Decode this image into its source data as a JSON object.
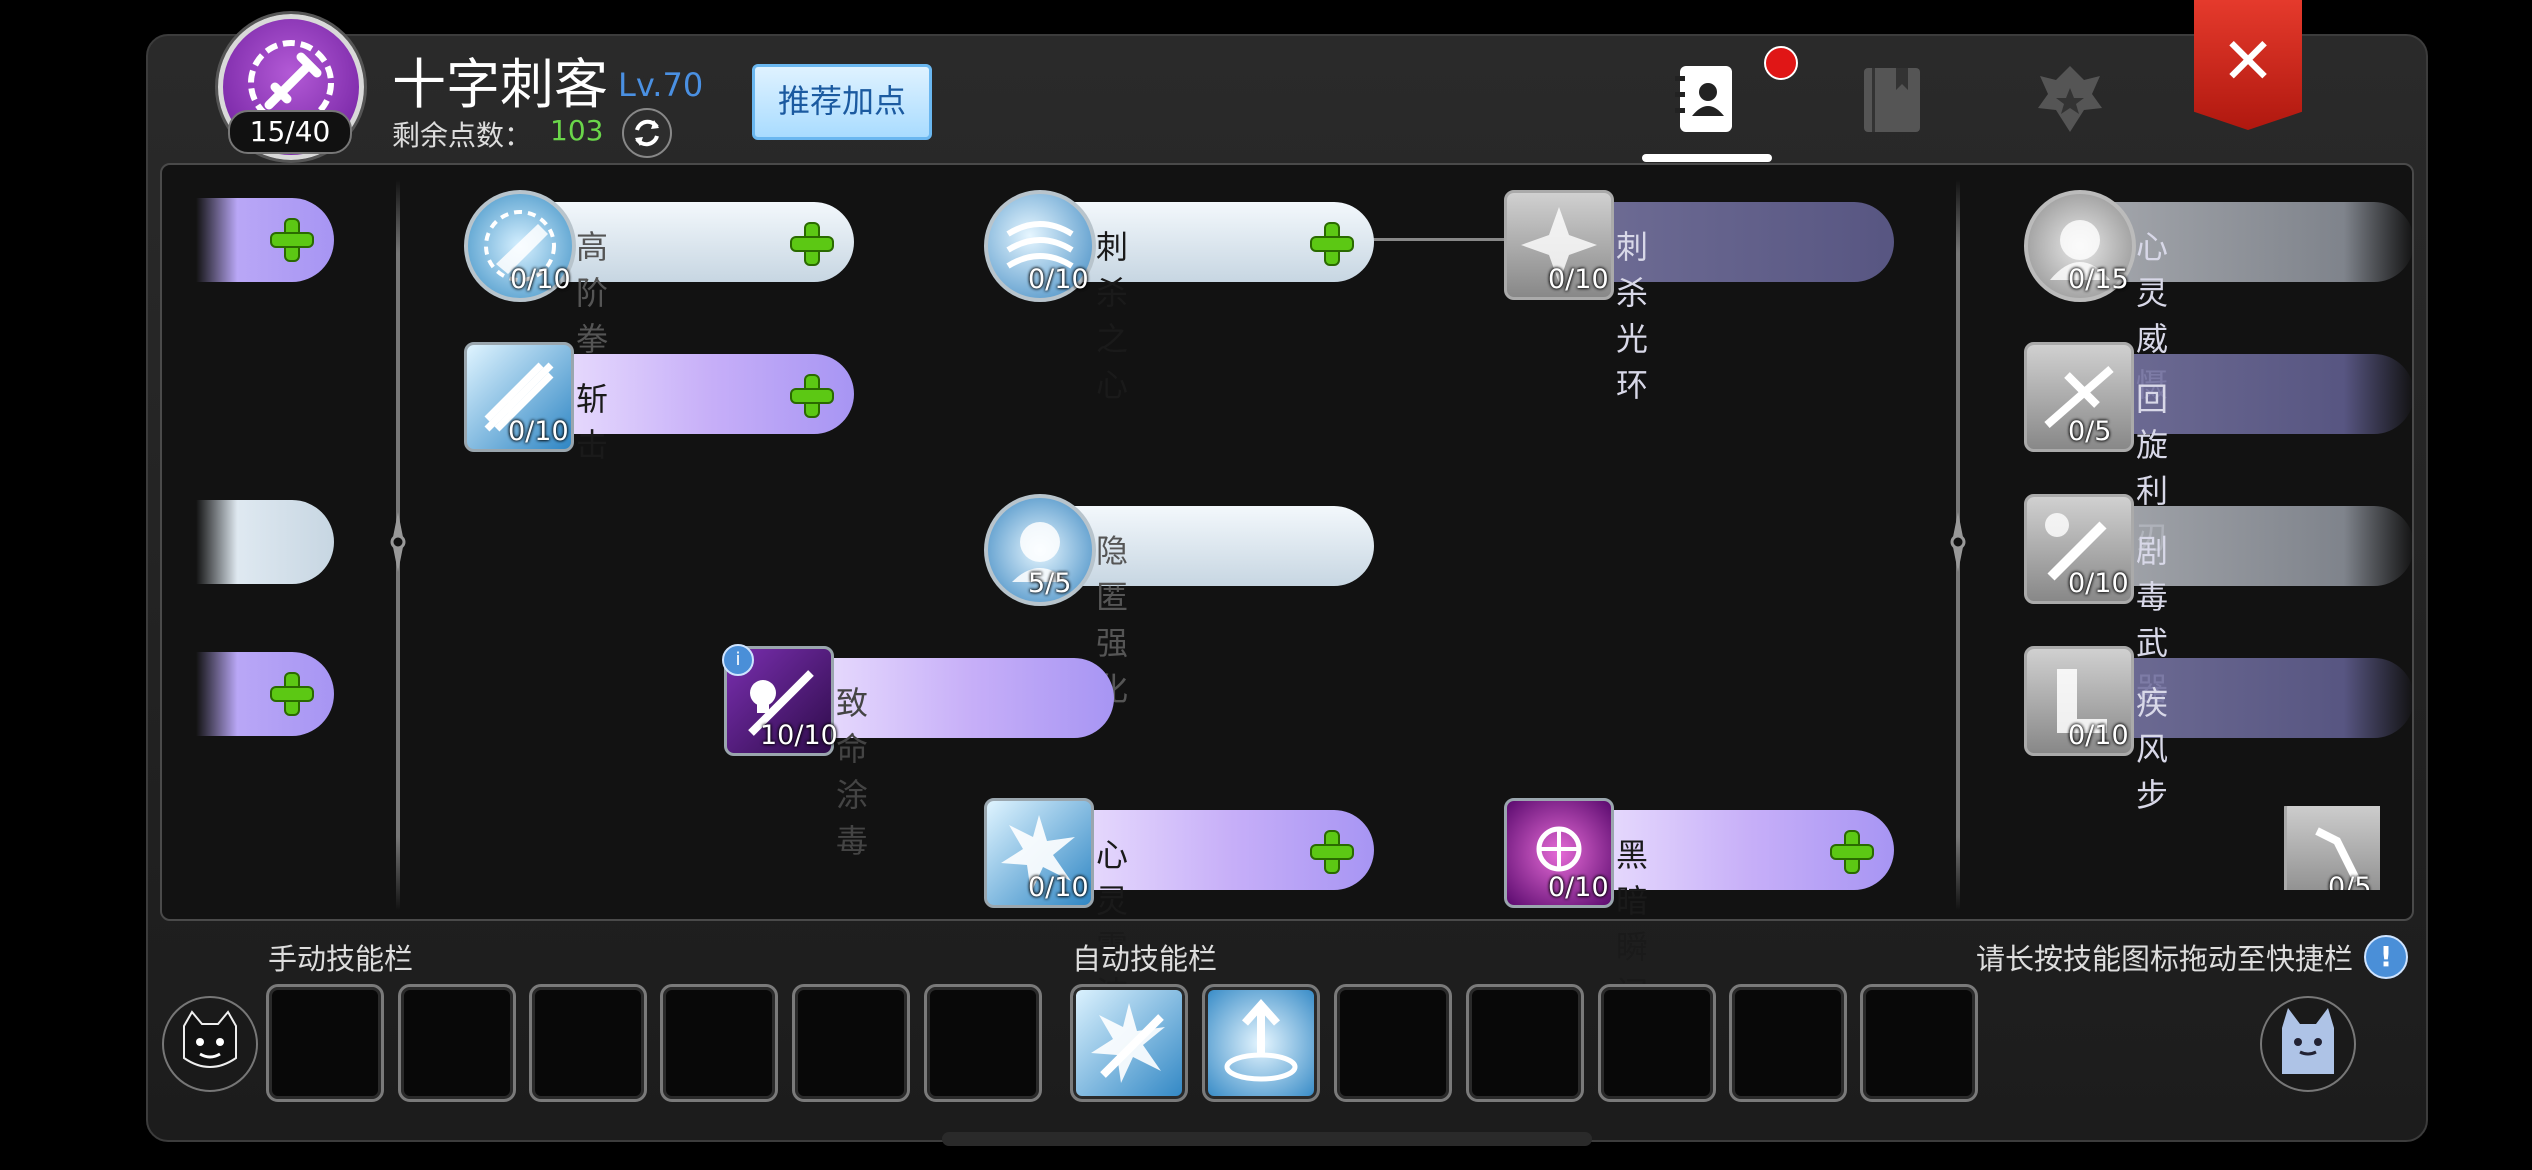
{
  "header": {
    "class_name": "十字刺客",
    "level": "Lv.70",
    "points_label": "剩余点数：",
    "points_value": "103",
    "emblem_count": "15/40",
    "recommend_label": "推荐加点",
    "tabs": [
      "profile-tab",
      "book-tab",
      "rank-tab"
    ],
    "close_glyph": "✕"
  },
  "skills": [
    {
      "name": "高阶拳刃",
      "count": "0/10"
    },
    {
      "name": "刺杀之心",
      "count": "0/10"
    },
    {
      "name": "刺杀光环",
      "count": "0/10"
    },
    {
      "name": "心灵威慑",
      "count": "0/15"
    },
    {
      "name": "斩击",
      "count": "0/10"
    },
    {
      "name": "回旋利刃",
      "count": "0/5"
    },
    {
      "name": "隐匿强化",
      "count": "5/5"
    },
    {
      "name": "剧毒武器",
      "count": "0/10"
    },
    {
      "name": "致命涂毒",
      "count": "10/10",
      "badge": "i"
    },
    {
      "name": "疾风步",
      "count": "0/10"
    },
    {
      "name": "心灵震波",
      "count": "0/10"
    },
    {
      "name": "黑暗瞬间",
      "count": "0/10"
    },
    {
      "name": "",
      "count": "0/5"
    }
  ],
  "bottom": {
    "manual_label": "手动技能栏",
    "auto_label": "自动技能栏",
    "hint": "请长按技能图标拖动至快捷栏",
    "hint_icon": "!"
  },
  "colors": {
    "accent": "#a795f3",
    "plus": "#5cc814",
    "close": "#d8281b",
    "level": "#4a90e2",
    "points": "#6ad64a"
  }
}
